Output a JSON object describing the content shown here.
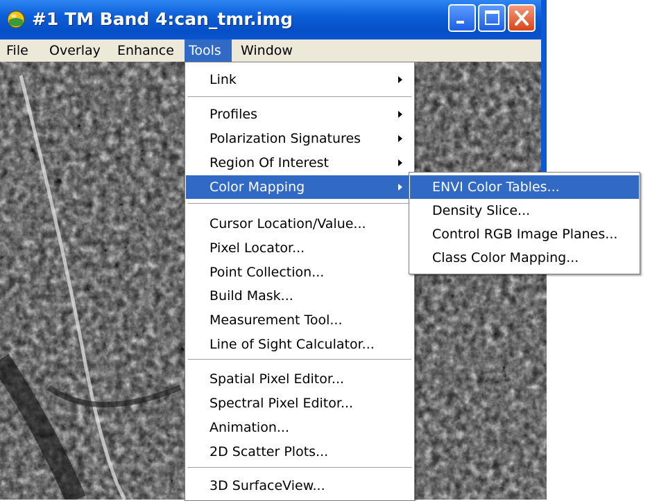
{
  "window": {
    "title": "#1 TM Band 4:can_tmr.img",
    "app_icon": "envi-globe-icon",
    "controls": [
      "minimize-icon",
      "maximize-icon",
      "close-icon"
    ]
  },
  "menubar": {
    "items": [
      "File",
      "Overlay",
      "Enhance",
      "Tools",
      "Window"
    ],
    "active": "Tools"
  },
  "tools_menu": {
    "items": [
      {
        "label": "Link",
        "submenu": true
      },
      {
        "label": "Profiles",
        "submenu": true
      },
      {
        "label": "Polarization Signatures",
        "submenu": true
      },
      {
        "label": "Region Of Interest",
        "submenu": true
      },
      {
        "label": "Color Mapping",
        "submenu": true,
        "highlighted": true
      },
      {
        "label": "Cursor Location/Value..."
      },
      {
        "label": "Pixel Locator..."
      },
      {
        "label": "Point Collection..."
      },
      {
        "label": "Build Mask..."
      },
      {
        "label": "Measurement Tool..."
      },
      {
        "label": "Line of Sight Calculator..."
      },
      {
        "label": "Spatial Pixel Editor..."
      },
      {
        "label": "Spectral Pixel Editor..."
      },
      {
        "label": "Animation..."
      },
      {
        "label": "2D Scatter Plots..."
      },
      {
        "label": "3D SurfaceView..."
      }
    ]
  },
  "color_mapping_submenu": {
    "items": [
      {
        "label": "ENVI Color Tables...",
        "highlighted": true
      },
      {
        "label": "Density Slice..."
      },
      {
        "label": "Control RGB Image Planes..."
      },
      {
        "label": "Class Color Mapping..."
      }
    ]
  },
  "colors": {
    "titlebar": "#0c5fd8",
    "menu_highlight": "#316ac5",
    "menubar_bg": "#ece9d8",
    "close_button": "#d8441b"
  }
}
